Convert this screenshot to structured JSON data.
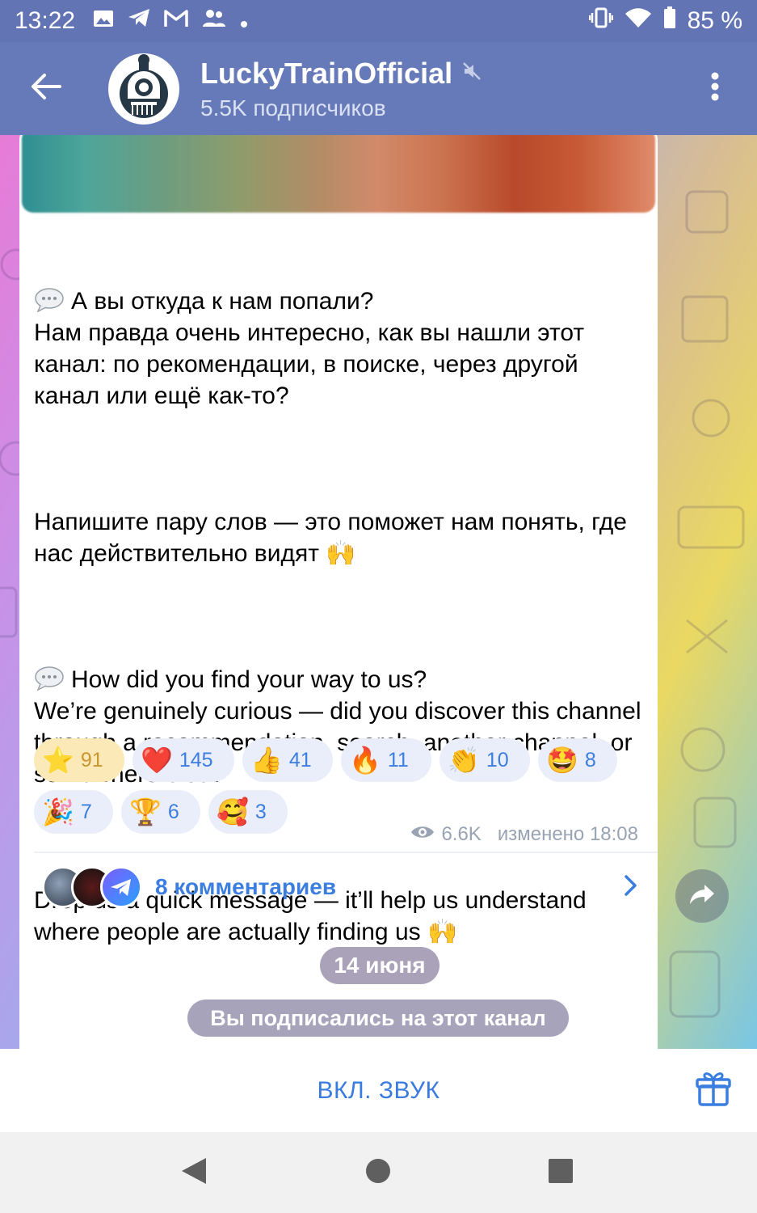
{
  "status_bar": {
    "time": "13:22",
    "battery": "85 %",
    "left_icons": [
      "gallery-icon",
      "telegram-icon",
      "gmail-icon",
      "contacts-icon",
      "dot-icon"
    ],
    "right_icons": [
      "vibrate-icon",
      "wifi-icon",
      "battery-icon"
    ]
  },
  "header": {
    "channel_name": "LuckyTrainOfficial",
    "subscribers": "5.5K подписчиков",
    "muted": true
  },
  "message": {
    "paragraphs": [
      "А вы откуда к нам попали?\nНам правда очень интересно, как вы нашли этот канал: по рекомендации, в поиске, через другой канал или ещё как-то?",
      "Напишите пару слов — это поможет нам понять, где нас действительно видят 🙌",
      "How did you find your way to us?\nWe’re genuinely curious — did you discover this channel through a recommendation, search, another channel, or somewhere else?",
      "Drop us a quick message — it’ll help us understand where people are actually finding us 🙌"
    ],
    "reactions_row1": [
      {
        "emoji": "⭐",
        "count": "91",
        "selected": true
      },
      {
        "emoji": "❤️",
        "count": "145"
      },
      {
        "emoji": "👍",
        "count": "41"
      },
      {
        "emoji": "🔥",
        "count": "11"
      },
      {
        "emoji": "👏",
        "count": "10"
      },
      {
        "emoji": "🤩",
        "count": "8"
      }
    ],
    "reactions_row2": [
      {
        "emoji": "🎉",
        "count": "7"
      },
      {
        "emoji": "🏆",
        "count": "6"
      },
      {
        "emoji": "🥰",
        "count": "3"
      }
    ],
    "views": "6.6K",
    "edited": "изменено 18:08",
    "comments": "8 комментариев"
  },
  "date_label": "14 июня",
  "service_message": "Вы подписались на этот канал",
  "bottom": {
    "mute_toggle": "ВКЛ. ЗВУК"
  },
  "colors": {
    "header_bg": "#6679b8",
    "statusbar_bg": "#6274b3",
    "accent": "#3b7ee0"
  }
}
